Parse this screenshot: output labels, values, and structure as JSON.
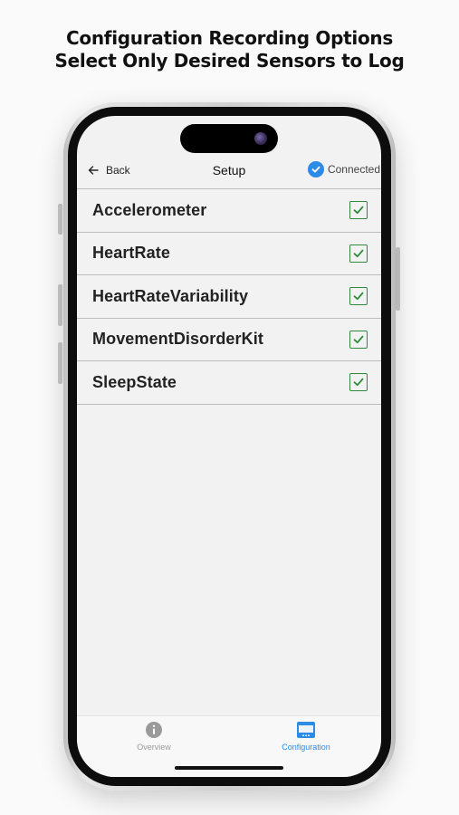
{
  "headline": {
    "line1": "Configuration Recording Options",
    "line2": "Select Only Desired Sensors to Log"
  },
  "nav": {
    "back_label": "Back",
    "title": "Setup",
    "status_label": "Connected",
    "icons": {
      "back": "arrow-left-icon",
      "status": "check-circle-icon"
    }
  },
  "sensors": [
    {
      "label": "Accelerometer",
      "checked": true
    },
    {
      "label": "HeartRate",
      "checked": true
    },
    {
      "label": "HeartRateVariability",
      "checked": true
    },
    {
      "label": "MovementDisorderKit",
      "checked": true
    },
    {
      "label": "SleepState",
      "checked": true
    }
  ],
  "tabs": [
    {
      "label": "Overview",
      "icon": "info-icon",
      "active": false
    },
    {
      "label": "Configuration",
      "icon": "window-icon",
      "active": true
    }
  ],
  "colors": {
    "accent": "#2c8be6",
    "check": "#2e8b3e",
    "inactive_tab": "#9a9a9a",
    "screen_bg": "#f2f2f2"
  }
}
